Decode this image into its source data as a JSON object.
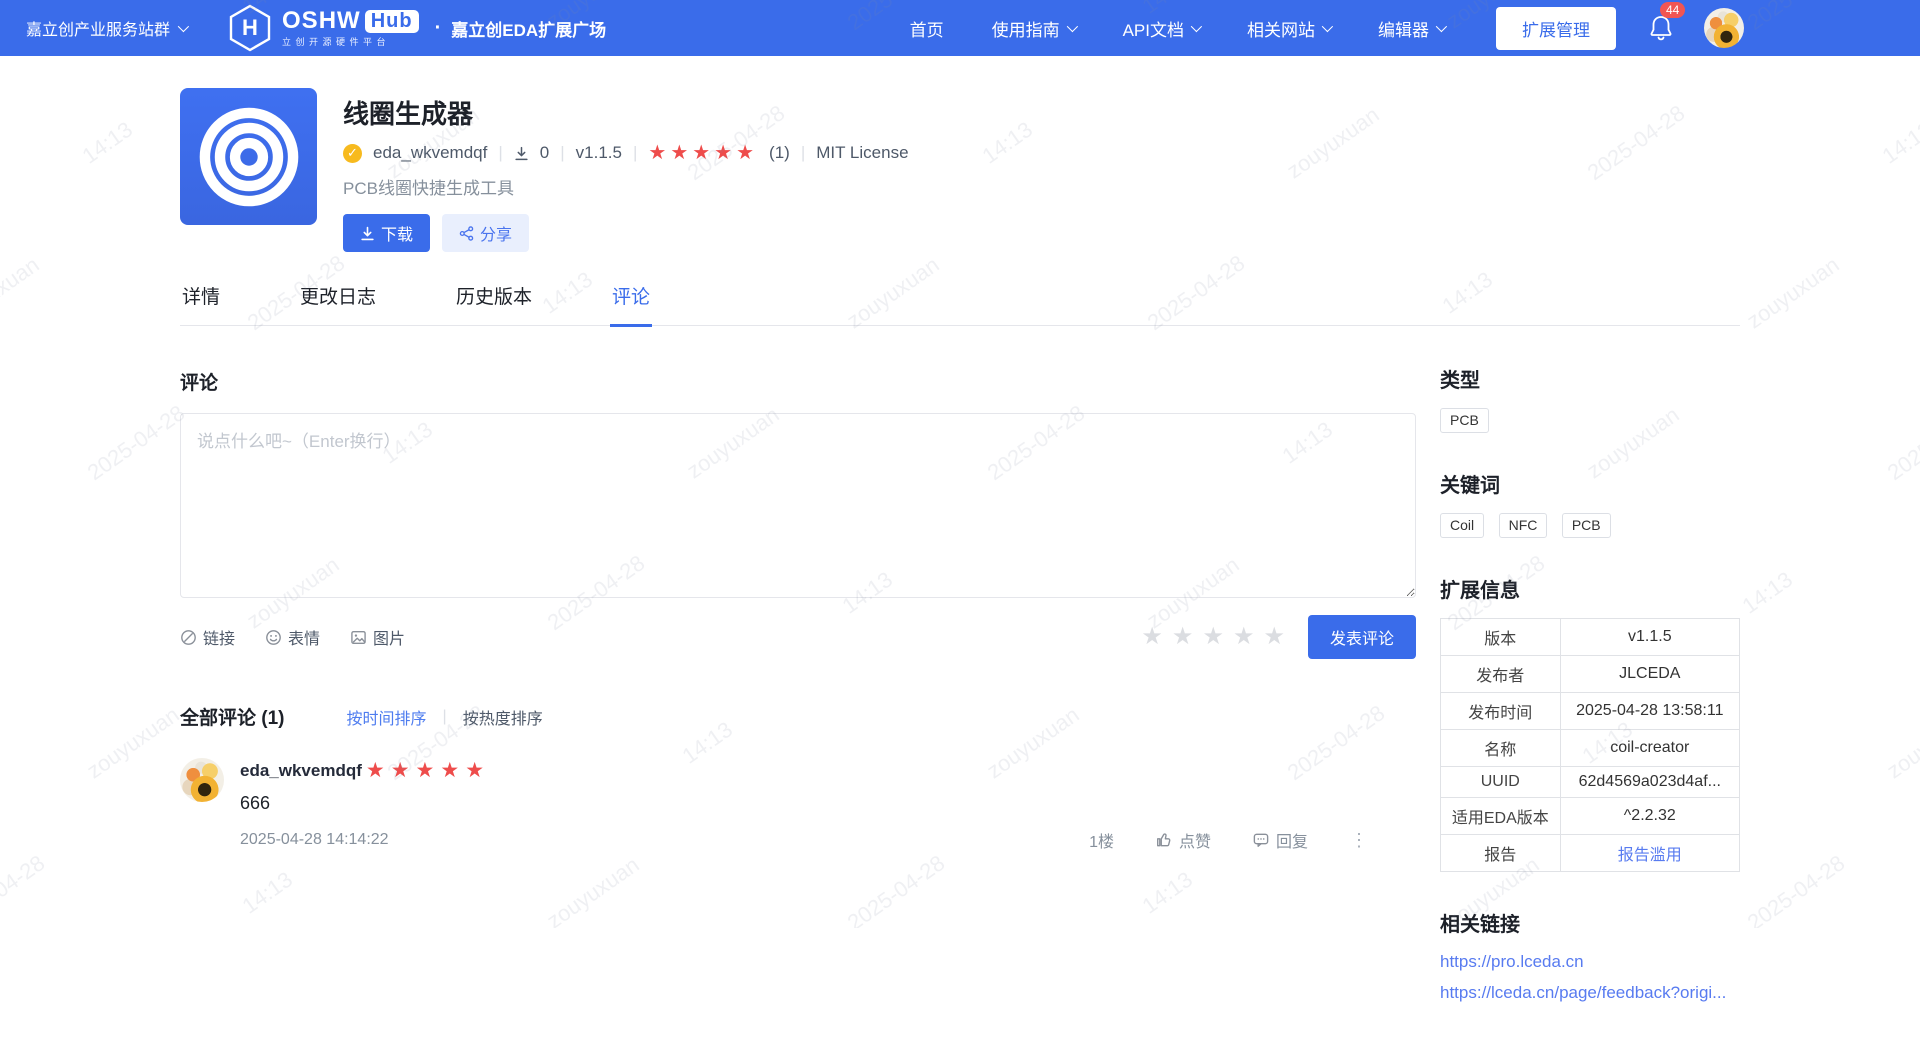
{
  "watermark": {
    "texts": [
      "2025-04-28",
      "14:13",
      "zouyuxuan"
    ]
  },
  "navbar": {
    "site_group": "嘉立创产业服务站群",
    "logo": {
      "oshw": "OSHW",
      "hub": "Hub",
      "tagline": "立创开源硬件平台"
    },
    "dot": "·",
    "site_title": "嘉立创EDA扩展广场",
    "menu": [
      {
        "label": "首页"
      },
      {
        "label": "使用指南"
      },
      {
        "label": "API文档"
      },
      {
        "label": "相关网站"
      },
      {
        "label": "编辑器"
      }
    ],
    "manage_button": "扩展管理",
    "notification_count": "44"
  },
  "header": {
    "title": "线圈生成器",
    "author": "eda_wkvemdqf",
    "downloads": "0",
    "version": "v1.1.5",
    "stars": "★★★★★",
    "rating_count": "(1)",
    "license": "MIT License",
    "description": "PCB线圈快捷生成工具",
    "download_button": "下载",
    "share_button": "分享",
    "separator": "|"
  },
  "tabs": [
    {
      "label": "详情"
    },
    {
      "label": "更改日志"
    },
    {
      "label": "历史版本"
    },
    {
      "label": "评论"
    }
  ],
  "comments": {
    "heading": "评论",
    "placeholder": "说点什么吧~（Enter换行）",
    "toolbar": {
      "link": "链接",
      "emoji": "表情",
      "image": "图片"
    },
    "rating_input_stars": "★★★★★",
    "submit": "发表评论",
    "all_heading": "全部评论 (1)",
    "sort_time": "按时间排序",
    "sort_sep": "|",
    "sort_hot": "按热度排序",
    "items": [
      {
        "author": "eda_wkvemdqf",
        "stars": "★★★★★",
        "text": "666",
        "time": "2025-04-28 14:14:22",
        "floor": "1楼",
        "like": "点赞",
        "reply": "回复",
        "more": "⋮"
      }
    ]
  },
  "sidebar": {
    "type_heading": "类型",
    "types": [
      "PCB"
    ],
    "keywords_heading": "关键词",
    "keywords": [
      "Coil",
      "NFC",
      "PCB"
    ],
    "info_heading": "扩展信息",
    "info_rows": [
      [
        "版本",
        "v1.1.5"
      ],
      [
        "发布者",
        "JLCEDA"
      ],
      [
        "发布时间",
        "2025-04-28 13:58:11"
      ],
      [
        "名称",
        "coil-creator"
      ],
      [
        "UUID",
        "62d4569a023d4af..."
      ],
      [
        "适用EDA版本",
        "^2.2.32"
      ],
      [
        "报告",
        "报告滥用"
      ]
    ],
    "links_heading": "相关链接",
    "links": [
      "https://pro.lceda.cn",
      "https://lceda.cn/page/feedback?origi..."
    ]
  },
  "colors": {
    "navbar_blue": "#3a6cea",
    "accent_blue": "#3a6cea",
    "link_blue": "#587bf0",
    "star_red": "#ee4c4b",
    "star_grey": "#dbdde1",
    "badge_red": "#f15553",
    "verified_gold": "#f7ba1e"
  }
}
